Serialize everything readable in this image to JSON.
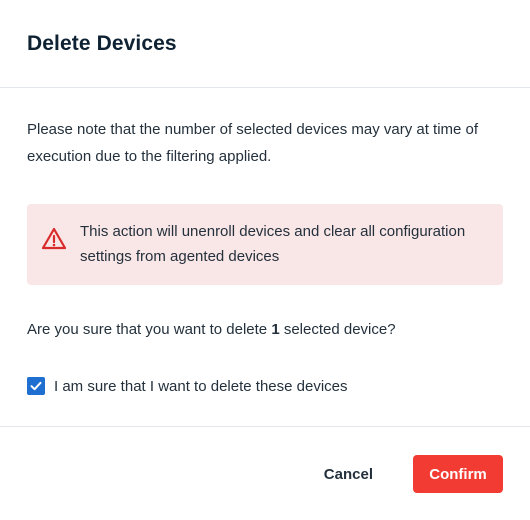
{
  "dialog": {
    "title": "Delete Devices",
    "note": "Please note that the number of selected devices may vary at time of execution due to the filtering applied.",
    "alert": {
      "icon": "warning-triangle-icon",
      "text": "This action will unenroll devices and clear all configuration settings from agented devices",
      "background_color": "#f9e6e6",
      "icon_color": "#d92b2b"
    },
    "question": {
      "prefix": "Are you sure that you want to delete ",
      "count": "1",
      "suffix": " selected device?"
    },
    "confirm_checkbox": {
      "label": "I am sure that I want to delete these devices",
      "checked": true,
      "color": "#1f6fd1"
    },
    "buttons": {
      "cancel_label": "Cancel",
      "confirm_label": "Confirm",
      "confirm_color": "#f23c33"
    }
  }
}
